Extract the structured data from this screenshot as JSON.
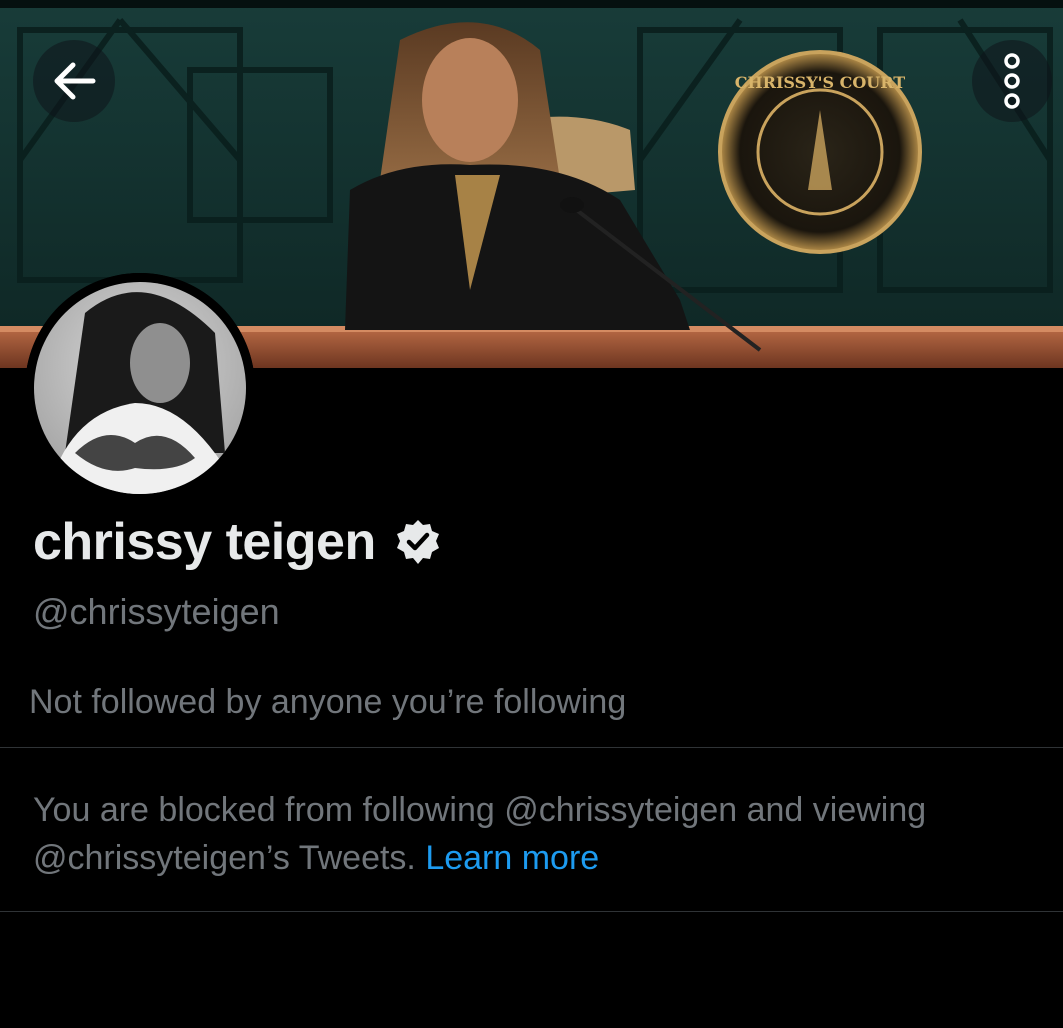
{
  "header": {
    "back_icon": "arrow-left-icon",
    "more_icon": "more-vertical-icon",
    "banner_seal_text": "CHRISSY'S COURT"
  },
  "profile": {
    "display_name": "chrissy teigen",
    "verified": true,
    "handle": "@chrissyteigen",
    "followers_note": "Not followed by anyone you’re following"
  },
  "blocked_notice": {
    "line1": "You are blocked from following @chrissyteigen and viewing",
    "line2": "@chrissyteigen’s Tweets.",
    "learn_more": "Learn more"
  },
  "colors": {
    "background": "#000000",
    "primary_text": "#e7e9ea",
    "secondary_text": "#71767b",
    "link": "#1d9bf0",
    "divider": "#2f3336"
  }
}
